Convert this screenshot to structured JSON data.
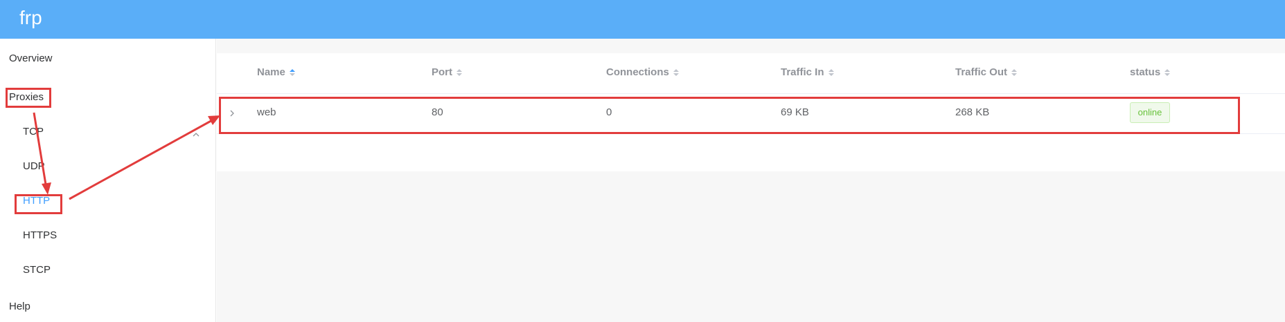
{
  "app": {
    "title": "frp"
  },
  "sidebar": {
    "items": [
      {
        "label": "Overview"
      },
      {
        "label": "Proxies"
      },
      {
        "label": "TCP"
      },
      {
        "label": "UDP"
      },
      {
        "label": "HTTP"
      },
      {
        "label": "HTTPS"
      },
      {
        "label": "STCP"
      },
      {
        "label": "Help"
      }
    ],
    "active": "HTTP"
  },
  "table": {
    "columns": [
      "Name",
      "Port",
      "Connections",
      "Traffic In",
      "Traffic Out",
      "status"
    ],
    "rows": [
      {
        "name": "web",
        "port": "80",
        "connections": "0",
        "traffic_in": "69 KB",
        "traffic_out": "268 KB",
        "status": "online"
      }
    ]
  },
  "colors": {
    "header": "#5aaef8",
    "active": "#409eff",
    "annotation": "#e23c3c",
    "status_online": "#67c23a"
  }
}
